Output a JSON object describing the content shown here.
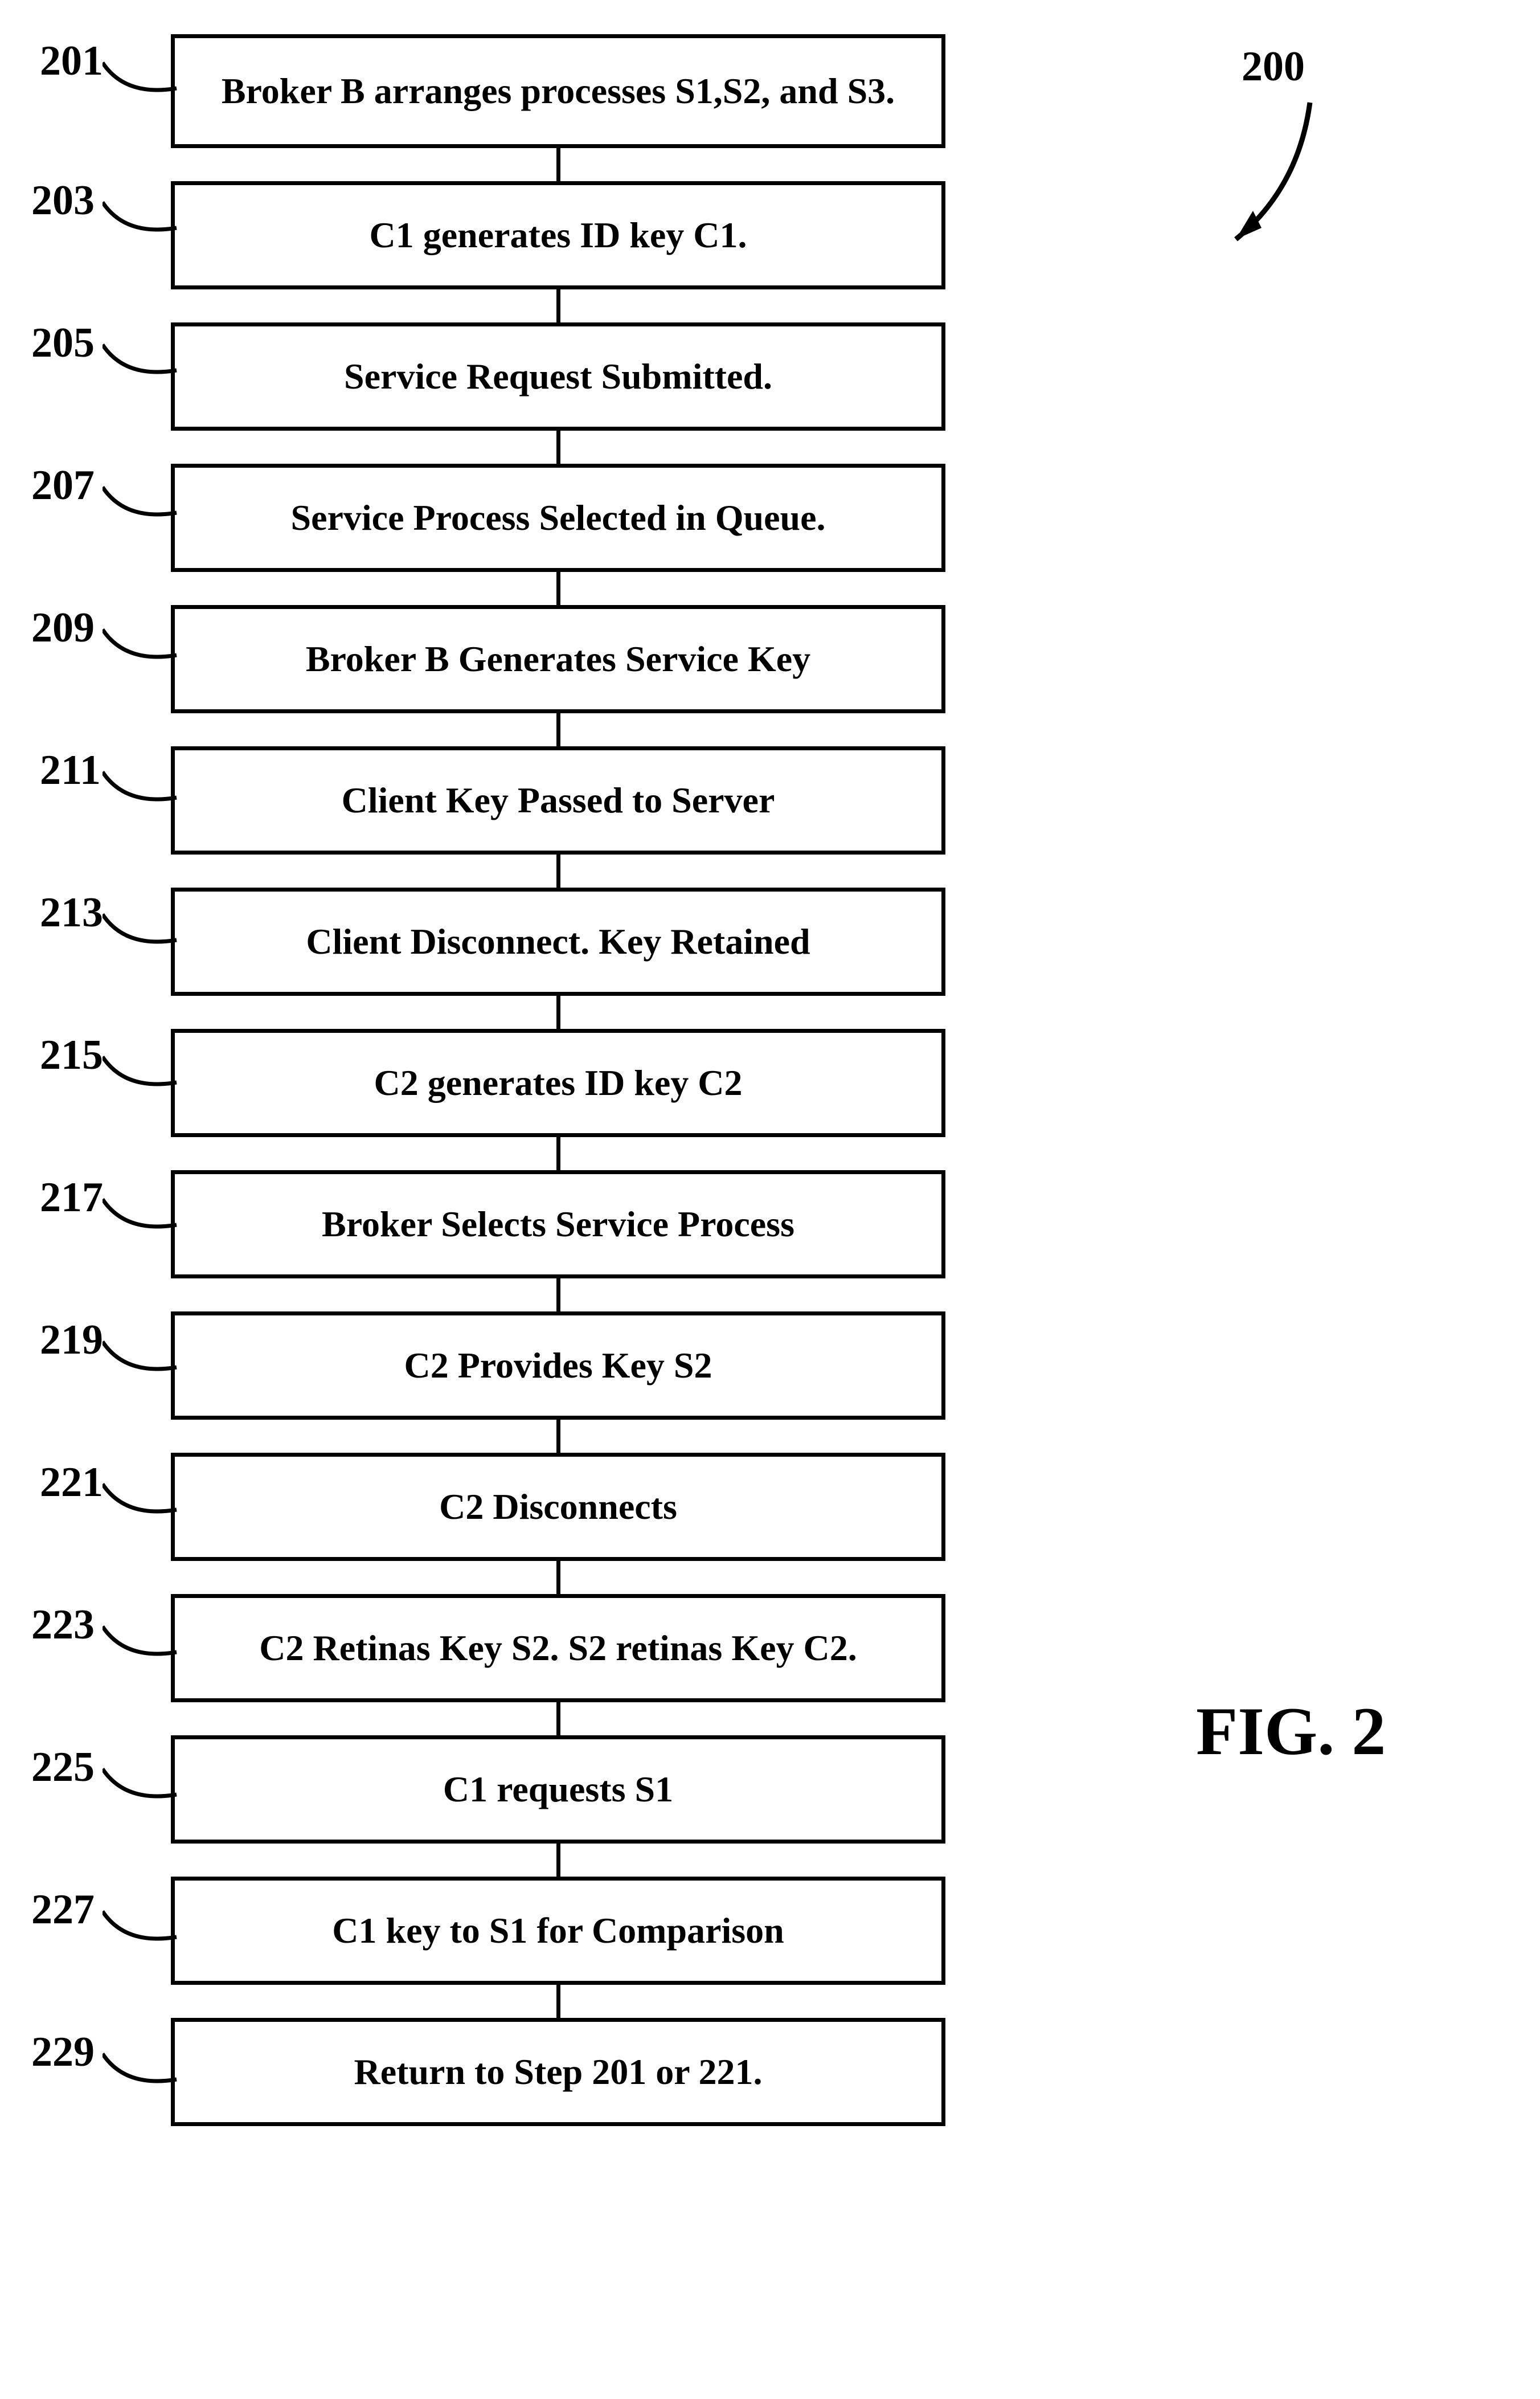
{
  "figure_label": "FIG. 2",
  "pointer_200": "200",
  "steps": [
    {
      "num": "201",
      "text": "Broker B arranges processes S1,S2, and S3.",
      "cls": "first"
    },
    {
      "num": "203",
      "text": "C1 generates ID key C1.",
      "cls": "norm"
    },
    {
      "num": "205",
      "text": "Service Request Submitted.",
      "cls": "norm"
    },
    {
      "num": "207",
      "text": "Service Process Selected in Queue.",
      "cls": "norm"
    },
    {
      "num": "209",
      "text": "Broker B Generates Service Key",
      "cls": "norm"
    },
    {
      "num": "211",
      "text": "Client Key Passed to Server",
      "cls": "norm"
    },
    {
      "num": "213",
      "text": "Client Disconnect. Key Retained",
      "cls": "norm"
    },
    {
      "num": "215",
      "text": "C2 generates ID key C2",
      "cls": "norm"
    },
    {
      "num": "217",
      "text": "Broker Selects Service Process",
      "cls": "norm"
    },
    {
      "num": "219",
      "text": "C2 Provides Key S2",
      "cls": "norm"
    },
    {
      "num": "221",
      "text": "C2 Disconnects",
      "cls": "norm"
    },
    {
      "num": "223",
      "text": "C2 Retinas Key S2. S2 retinas Key C2.",
      "cls": "norm"
    },
    {
      "num": "225",
      "text": "C1 requests S1",
      "cls": "norm"
    },
    {
      "num": "227",
      "text": "C1 key to S1 for Comparison",
      "cls": "norm"
    },
    {
      "num": "229",
      "text": "Return to Step 201 or 221.",
      "cls": "norm"
    }
  ],
  "chart_data": {
    "type": "flowchart",
    "title": "FIG. 2",
    "reference_numeral": 200,
    "sequence": [
      {
        "ref": 201,
        "label": "Broker B arranges processes S1,S2, and S3."
      },
      {
        "ref": 203,
        "label": "C1 generates ID key C1."
      },
      {
        "ref": 205,
        "label": "Service Request Submitted."
      },
      {
        "ref": 207,
        "label": "Service Process Selected in Queue."
      },
      {
        "ref": 209,
        "label": "Broker B Generates Service Key"
      },
      {
        "ref": 211,
        "label": "Client Key Passed to Server"
      },
      {
        "ref": 213,
        "label": "Client Disconnect. Key Retained"
      },
      {
        "ref": 215,
        "label": "C2 generates ID key C2"
      },
      {
        "ref": 217,
        "label": "Broker Selects Service Process"
      },
      {
        "ref": 219,
        "label": "C2 Provides Key S2"
      },
      {
        "ref": 221,
        "label": "C2 Disconnects"
      },
      {
        "ref": 223,
        "label": "C2 Retinas Key S2. S2 retinas Key C2."
      },
      {
        "ref": 225,
        "label": "C1 requests S1"
      },
      {
        "ref": 227,
        "label": "C1 key to S1 for Comparison"
      },
      {
        "ref": 229,
        "label": "Return to Step 201 or 221."
      }
    ],
    "layout": "vertical-sequence",
    "connections": "top-to-bottom single line between each consecutive box"
  }
}
